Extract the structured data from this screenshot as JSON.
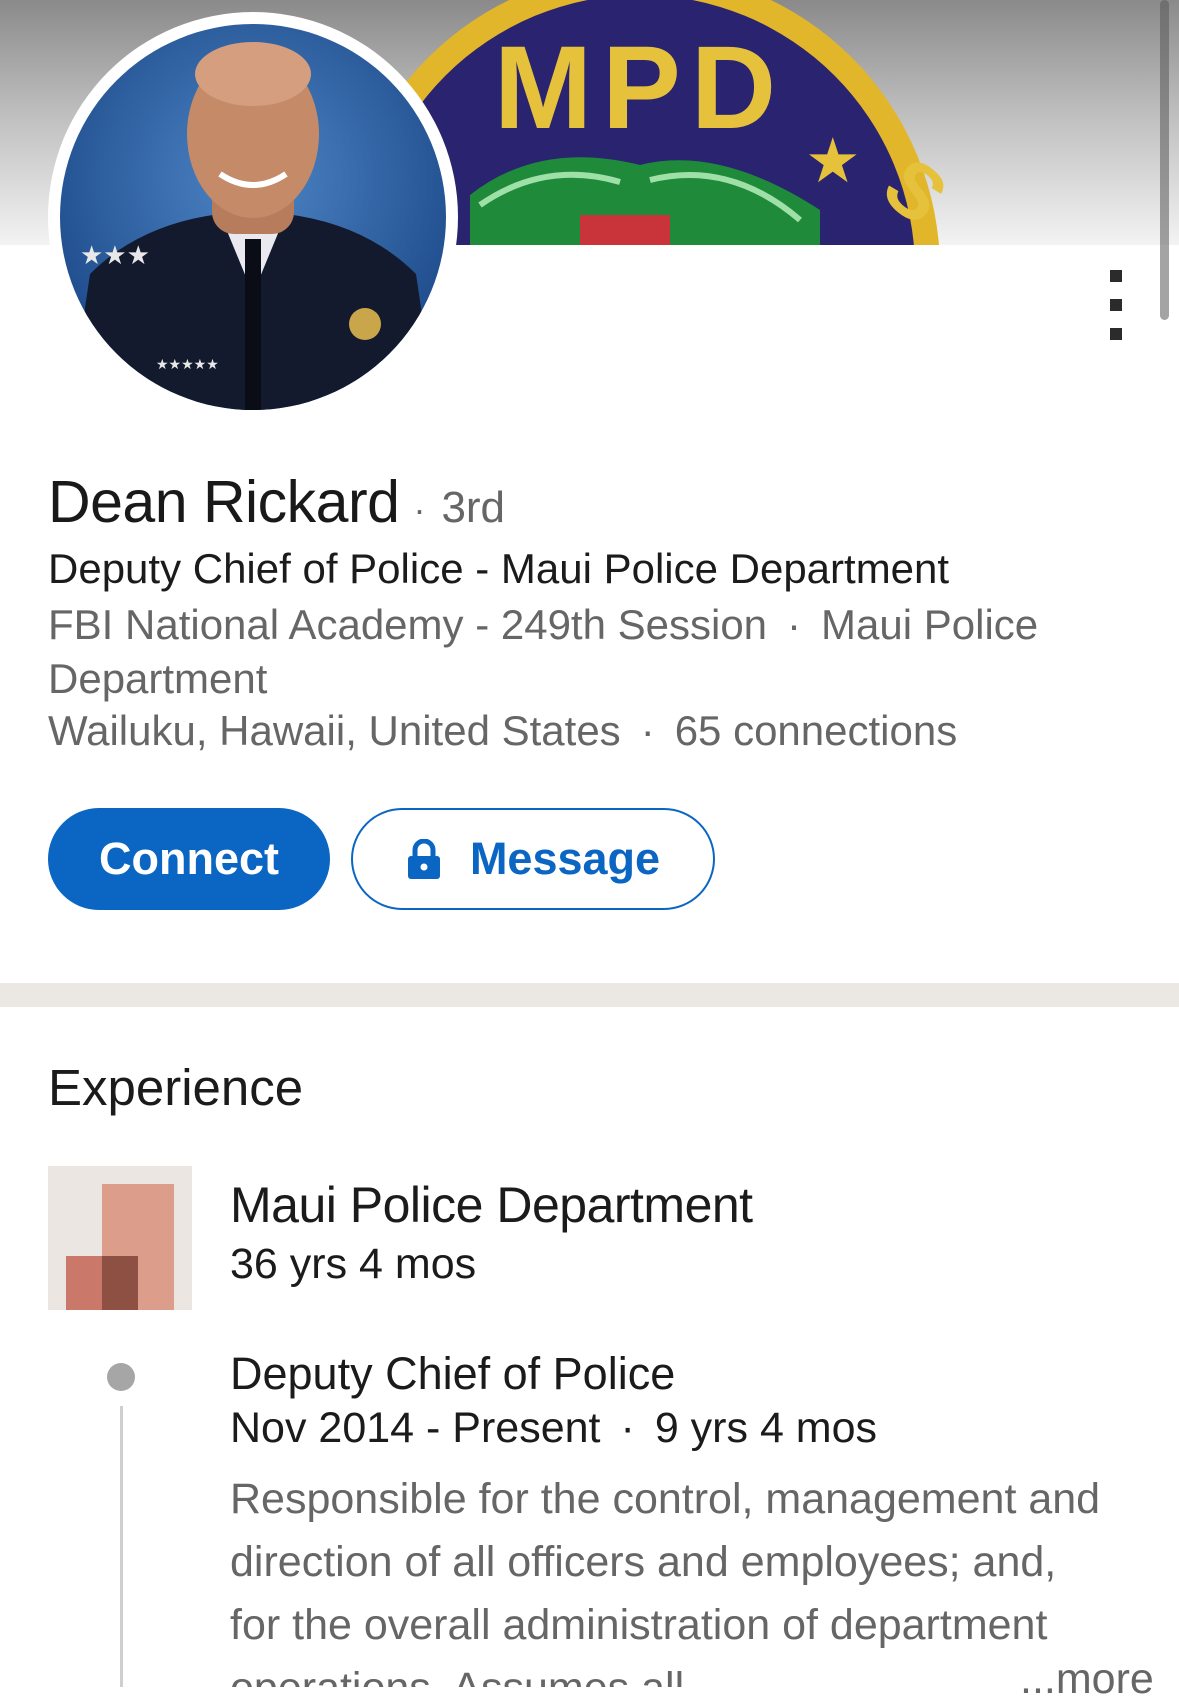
{
  "profile": {
    "name": "Dean Rickard",
    "degree": "3rd",
    "headline": "Deputy Chief of Police - Maui Police Department",
    "education": "FBI National Academy - 249th Session",
    "education_org": "Maui Police Department",
    "location": "Wailuku, Hawaii, United States",
    "connections": "65 connections",
    "separator": "·"
  },
  "banner": {
    "seal_text": "MPD",
    "seal_text_2": "S"
  },
  "actions": {
    "connect_label": "Connect",
    "message_label": "Message"
  },
  "experience": {
    "title": "Experience",
    "company": "Maui Police Department",
    "company_duration": "36 yrs 4 mos",
    "role_title": "Deputy Chief of Police",
    "role_range": "Nov 2014 - Present",
    "role_length": "9 yrs 4 mos",
    "description": "Responsible for the control, management and direction of all officers and employees; and, for the overall administration of department operations. Assumes all",
    "see_more": "...more"
  },
  "colors": {
    "primary": "#0a66c2",
    "muted": "#666666",
    "divider": "#ebe8e3"
  },
  "icons": {
    "lock": "lock-icon",
    "more": "more-vertical-icon"
  }
}
